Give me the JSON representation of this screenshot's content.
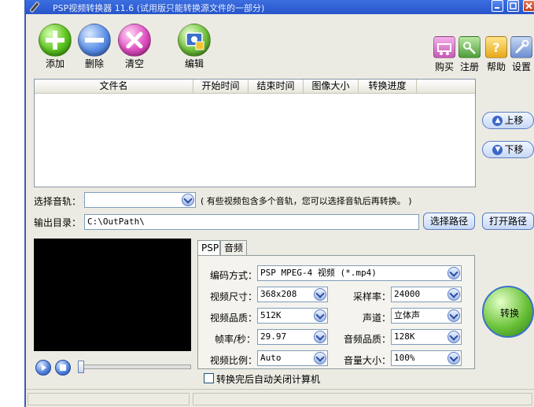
{
  "window": {
    "title": "PSP视频转换器 11.6 (试用版只能转换源文件的一部分)"
  },
  "toolbar": {
    "add": "添加",
    "delete": "删除",
    "clear": "清空",
    "edit": "编辑",
    "buy": "购买",
    "register": "注册",
    "help": "帮助",
    "settings": "设置"
  },
  "file_list": {
    "columns": [
      "文件名",
      "开始时间",
      "结束时间",
      "图像大小",
      "转换进度"
    ],
    "rows": []
  },
  "side_buttons": {
    "move_up": "上移",
    "move_down": "下移"
  },
  "audio_track": {
    "label": "选择音轨：",
    "value": "",
    "hint": "( 有些视频包含多个音轨，您可以选择音轨后再转换。 )"
  },
  "output": {
    "label": "输出目录：",
    "path": "C:\\OutPath\\",
    "choose_path": "选择路径",
    "open_path": "打开路径"
  },
  "tabs": [
    "PSP",
    "音频"
  ],
  "settings": {
    "encoding_label": "编码方式：",
    "encoding_value": "PSP MPEG-4 视频 (*.mp4)",
    "video_size_label": "视频尺寸：",
    "video_size_value": "368x208",
    "sample_rate_label": "采样率：",
    "sample_rate_value": "24000",
    "video_quality_label": "视频品质：",
    "video_quality_value": "512K",
    "channel_label": "声道：",
    "channel_value": "立体声",
    "fps_label": "帧率/秒：",
    "fps_value": "29.97",
    "audio_quality_label": "音频品质：",
    "audio_quality_value": "128K",
    "aspect_label": "视频比例：",
    "aspect_value": "Auto",
    "volume_label": "音量大小：",
    "volume_value": "100%"
  },
  "convert_button": "转换",
  "shutdown_checkbox": {
    "label": "转换完后自动关闭计算机",
    "checked": false
  }
}
